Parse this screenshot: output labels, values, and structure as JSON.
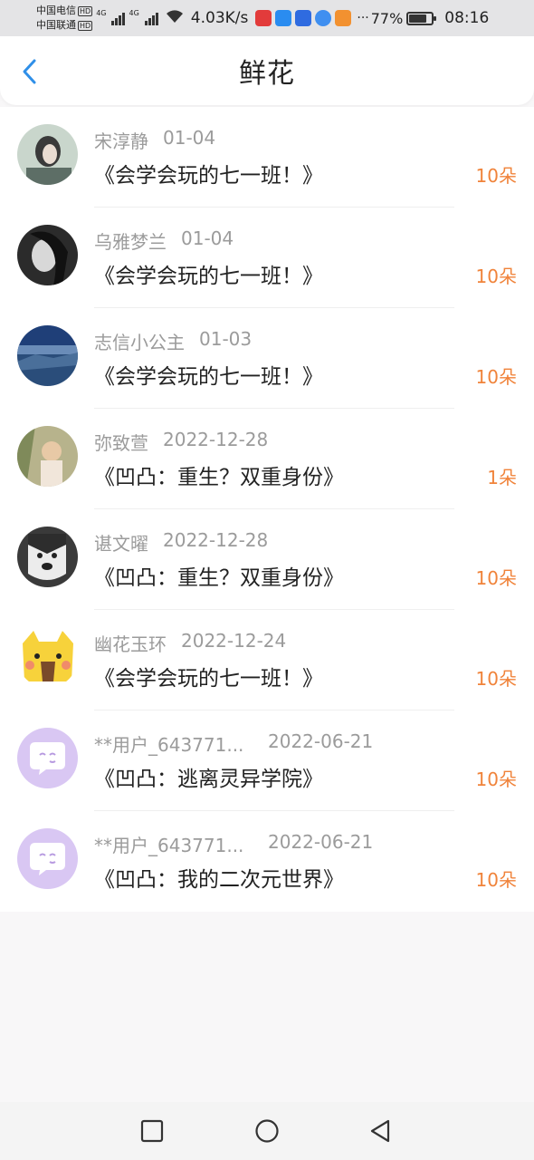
{
  "status_bar": {
    "carrier1": "中国电信",
    "carrier2": "中国联通",
    "hd": "HD",
    "net1": "4G",
    "net2": "4G",
    "speed": "4.03K/s",
    "more": "···",
    "battery": "77%",
    "battery_level": 0.77,
    "time": "08:16"
  },
  "header": {
    "title": "鲜花",
    "back_icon": "chevron-left-icon",
    "accent": "#2f8fe8"
  },
  "accent_count_color": "#f0833a",
  "items": [
    {
      "name": "宋淳静",
      "date": "01-04",
      "book": "《会学会玩的七一班！》",
      "count": "10朵"
    },
    {
      "name": "乌雅梦兰",
      "date": "01-04",
      "book": "《会学会玩的七一班！》",
      "count": "10朵"
    },
    {
      "name": "志信小公主",
      "date": "01-03",
      "book": "《会学会玩的七一班！》",
      "count": "10朵"
    },
    {
      "name": "弥致萱",
      "date": "2022-12-28",
      "book": "《凹凸：重生？双重身份》",
      "count": "1朵"
    },
    {
      "name": "谌文曜",
      "date": "2022-12-28",
      "book": "《凹凸：重生？双重身份》",
      "count": "10朵"
    },
    {
      "name": "幽花玉环",
      "date": "2022-12-24",
      "book": "《会学会玩的七一班！》",
      "count": "10朵"
    },
    {
      "name": "**用户_643771...",
      "date": "2022-06-21",
      "book": "《凹凸：逃离灵异学院》",
      "count": "10朵"
    },
    {
      "name": "**用户_643771...",
      "date": "2022-06-21",
      "book": "《凹凸：我的二次元世界》",
      "count": "10朵"
    }
  ],
  "nav": {
    "recent": "square-icon",
    "home": "circle-icon",
    "back": "triangle-back-icon"
  }
}
